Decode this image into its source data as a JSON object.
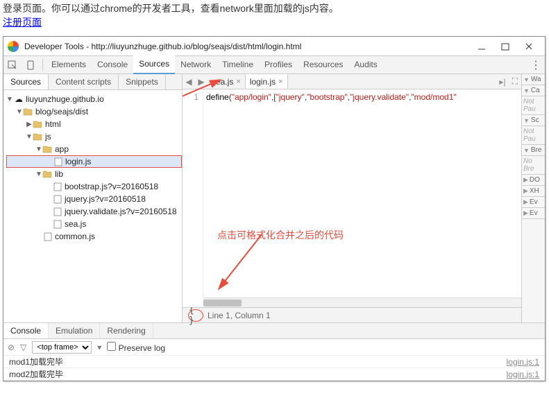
{
  "page": {
    "intro_text": "登录页面。你可以通过chrome的开发者工具，查看network里面加载的js内容。",
    "link_text": "注册页面"
  },
  "titlebar": {
    "title": "Developer Tools - http://liuyunzhuge.github.io/blog/seajs/dist/html/login.html"
  },
  "tabs": {
    "items": [
      "Elements",
      "Console",
      "Sources",
      "Network",
      "Timeline",
      "Profiles",
      "Resources",
      "Audits"
    ],
    "active": "Sources"
  },
  "sources_subtabs": {
    "items": [
      "Sources",
      "Content scripts",
      "Snippets"
    ],
    "active": "Sources"
  },
  "tree": {
    "root": "liuyunzhuge.github.io",
    "nodes": [
      {
        "d": 1,
        "t": "folder",
        "open": true,
        "label": "blog/seajs/dist"
      },
      {
        "d": 2,
        "t": "folder",
        "open": false,
        "label": "html"
      },
      {
        "d": 2,
        "t": "folder",
        "open": true,
        "label": "js"
      },
      {
        "d": 3,
        "t": "folder",
        "open": true,
        "label": "app"
      },
      {
        "d": 4,
        "t": "file",
        "label": "login.js",
        "sel": true
      },
      {
        "d": 3,
        "t": "folder",
        "open": true,
        "label": "lib"
      },
      {
        "d": 4,
        "t": "file",
        "label": "bootstrap.js?v=20160518"
      },
      {
        "d": 4,
        "t": "file",
        "label": "jquery.js?v=20160518"
      },
      {
        "d": 4,
        "t": "file",
        "label": "jquery.validate.js?v=20160518"
      },
      {
        "d": 4,
        "t": "file",
        "label": "sea.js"
      },
      {
        "d": 3,
        "t": "file",
        "label": "common.js"
      }
    ]
  },
  "file_tabs": {
    "items": [
      {
        "label": "sea.js",
        "active": false
      },
      {
        "label": "login.js",
        "active": true
      }
    ]
  },
  "code": {
    "line_no": "1",
    "segments": [
      {
        "cls": "tok-fn",
        "text": "define"
      },
      {
        "cls": "",
        "text": "("
      },
      {
        "cls": "tok-str",
        "text": "\"app/login\""
      },
      {
        "cls": "",
        "text": ",["
      },
      {
        "cls": "tok-str",
        "text": "\"jquery\""
      },
      {
        "cls": "",
        "text": ","
      },
      {
        "cls": "tok-str",
        "text": "\"bootstrap\""
      },
      {
        "cls": "",
        "text": ","
      },
      {
        "cls": "tok-str",
        "text": "\"jquery.validate\""
      },
      {
        "cls": "",
        "text": ","
      },
      {
        "cls": "tok-str",
        "text": "\"mod/mod1\""
      }
    ],
    "status": "Line 1, Column 1"
  },
  "right_panels": {
    "items": [
      {
        "label": "Wa",
        "open": true
      },
      {
        "label": "Ca",
        "open": true
      },
      {
        "label": "Not\nPau",
        "italic": true
      },
      {
        "label": "Sc",
        "open": true
      },
      {
        "label": "Not\nPau",
        "italic": true
      },
      {
        "label": "Bre",
        "open": true
      },
      {
        "label": "No\nBre",
        "italic": true
      },
      {
        "label": "DO",
        "open": false
      },
      {
        "label": "XH",
        "open": false
      },
      {
        "label": "Ev",
        "open": false
      },
      {
        "label": "Ev",
        "open": false
      }
    ]
  },
  "drawer": {
    "tabs": [
      "Console",
      "Emulation",
      "Rendering"
    ],
    "active": "Console",
    "frame_selector": "<top frame>",
    "preserve_log_label": "Preserve log",
    "logs": [
      {
        "msg": "mod1加载完毕",
        "src": "login.js:1"
      },
      {
        "msg": "mod2加载完毕",
        "src": "login.js:1"
      }
    ]
  },
  "annotations": {
    "format_text": "点击可格式化合并之后的代码"
  }
}
